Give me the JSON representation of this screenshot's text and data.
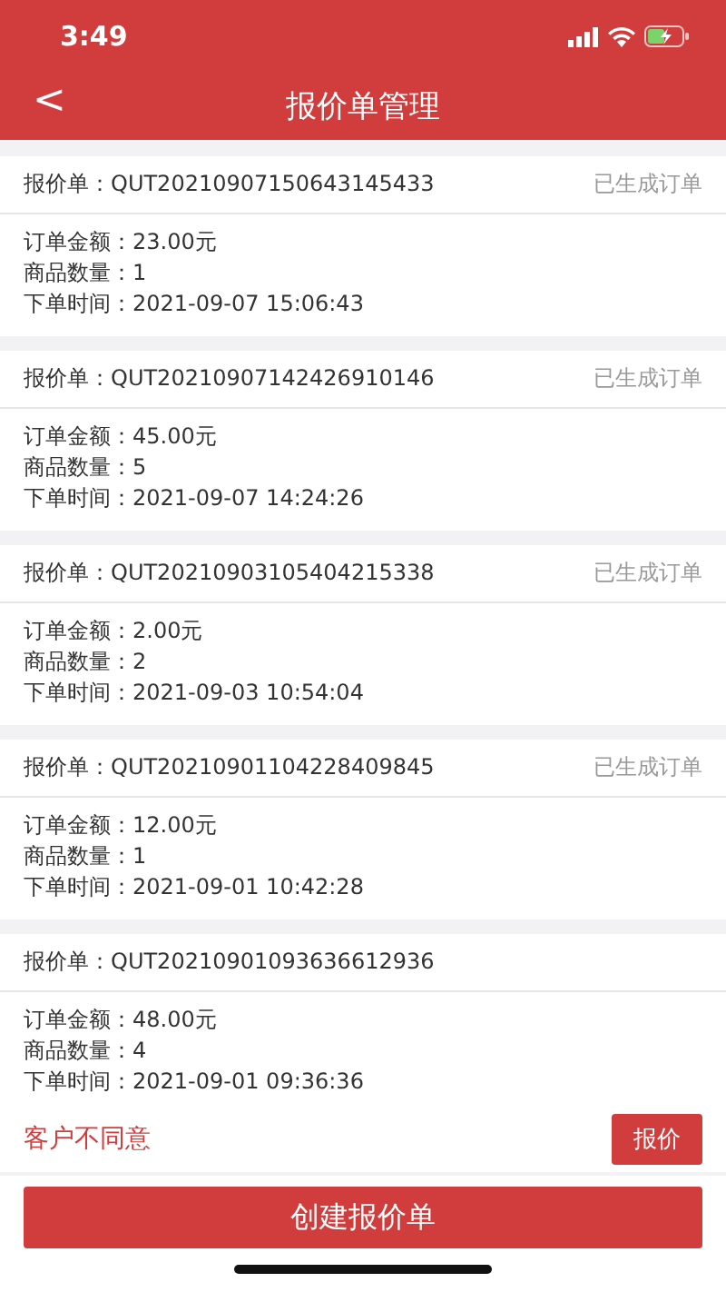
{
  "status_bar": {
    "time": "3:49"
  },
  "nav": {
    "back": "<",
    "title": "报价单管理"
  },
  "quotes": [
    {
      "label": "报价单：",
      "number": "QUT20210907150643145433",
      "status": "已生成订单",
      "fields": [
        {
          "label": "订单金额：",
          "value": "23.00元"
        },
        {
          "label": "商品数量：",
          "value": "1"
        },
        {
          "label": "下单时间：",
          "value": "2021-09-07 15:06:43"
        }
      ]
    },
    {
      "label": "报价单：",
      "number": "QUT20210907142426910146",
      "status": "已生成订单",
      "fields": [
        {
          "label": "订单金额：",
          "value": "45.00元"
        },
        {
          "label": "商品数量：",
          "value": "5"
        },
        {
          "label": "下单时间：",
          "value": "2021-09-07 14:24:26"
        }
      ]
    },
    {
      "label": "报价单：",
      "number": "QUT20210903105404215338",
      "status": "已生成订单",
      "fields": [
        {
          "label": "订单金额：",
          "value": "2.00元"
        },
        {
          "label": "商品数量：",
          "value": "2"
        },
        {
          "label": "下单时间：",
          "value": "2021-09-03 10:54:04"
        }
      ]
    },
    {
      "label": "报价单：",
      "number": "QUT20210901104228409845",
      "status": "已生成订单",
      "fields": [
        {
          "label": "订单金额：",
          "value": "12.00元"
        },
        {
          "label": "商品数量：",
          "value": "1"
        },
        {
          "label": "下单时间：",
          "value": "2021-09-01 10:42:28"
        }
      ]
    },
    {
      "label": "报价单：",
      "number": "QUT20210901093636612936",
      "fields": [
        {
          "label": "订单金额：",
          "value": "48.00元"
        },
        {
          "label": "商品数量：",
          "value": "4"
        },
        {
          "label": "下单时间：",
          "value": "2021-09-01 09:36:36"
        }
      ],
      "footer": {
        "note": "客户不同意",
        "button": "报价"
      }
    }
  ],
  "create_button": "创建报价单"
}
